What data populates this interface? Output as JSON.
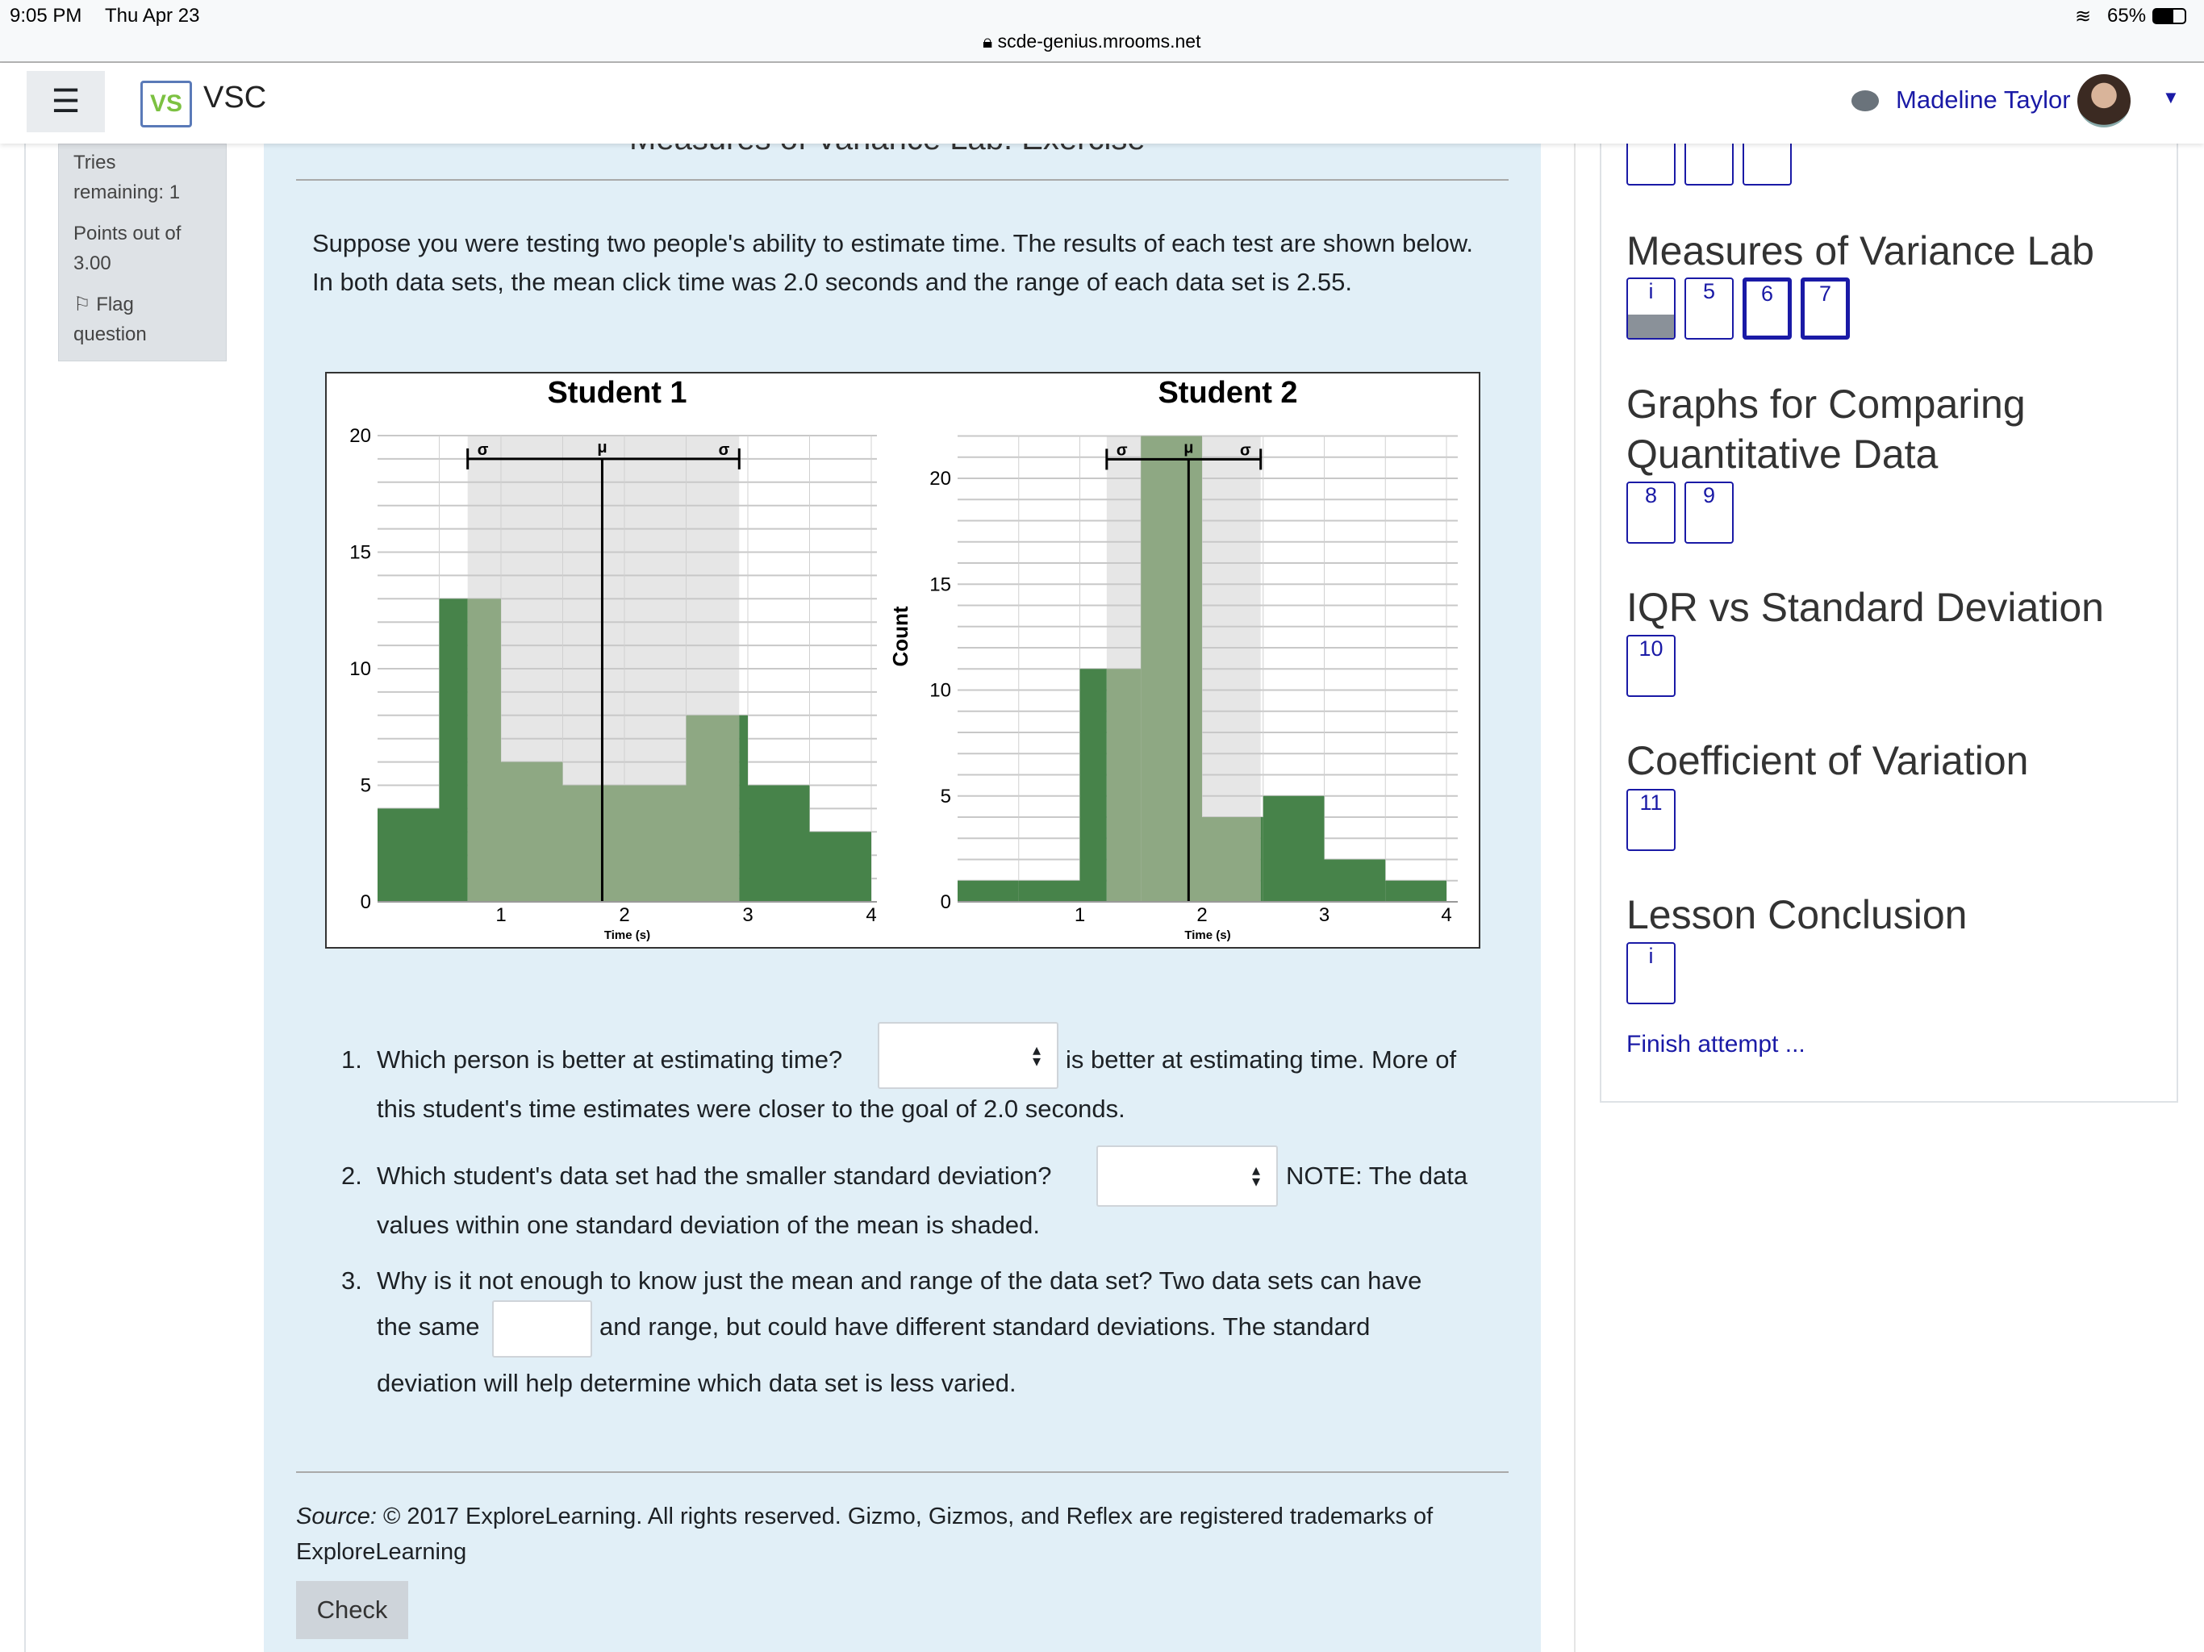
{
  "statusbar": {
    "time": "9:05 PM",
    "date": "Thu Apr 23",
    "url": "scde-genius.mrooms.net",
    "battery": "65%"
  },
  "header": {
    "site": "VSC",
    "user": "Madeline Taylor",
    "icons": [
      "menu-icon",
      "logo",
      "chat-icon",
      "avatar",
      "caret-down-icon"
    ]
  },
  "info": {
    "tries": "Tries remaining: 1",
    "points": "Points out of 3.00",
    "flag": "Flag question"
  },
  "main": {
    "title": "Measures of Variance Lab: Exercise",
    "intro": "Suppose you were testing two people's ability to estimate time. The results of each test are shown below. In both data sets, the mean click time was 2.0 seconds and the range of each data set is 2.55.",
    "q1_num": "1.",
    "q1_a": "Which person is better at estimating time?",
    "q1_b": "is better at estimating time. More of",
    "q1_c": "this student's time estimates were closer to the goal of 2.0 seconds.",
    "q2_num": "2.",
    "q2_a": "Which student's data set had the smaller standard deviation?",
    "q2_b": "NOTE: The data",
    "q2_c": "values within one standard deviation of the mean is shaded.",
    "q3_num": "3.",
    "q3_a": "Why is it not enough to know just the mean and range of the data set? Two data sets can have",
    "q3_b": "the same",
    "q3_c": "and range, but could have different standard deviations. The standard",
    "q3_d": "deviation will help determine which data set is less varied.",
    "select1": "",
    "select2": "",
    "input3": "",
    "source_label": "Source:",
    "source": " © 2017 ExploreLearning.  All rights reserved.  Gizmo, Gizmos, and Reflex are registered trademarks of",
    "source2": "ExploreLearning",
    "check": "Check"
  },
  "nav": {
    "sections": [
      {
        "title": "Measures of Variance Lab",
        "items": [
          "i",
          "5",
          "6",
          "7"
        ]
      },
      {
        "title": "Graphs for Comparing",
        "title2": "Quantitative Data",
        "items": [
          "8",
          "9"
        ]
      },
      {
        "title": "IQR vs Standard Deviation",
        "items": [
          "10"
        ]
      },
      {
        "title": "Coefficient of Variation",
        "items": [
          "11"
        ]
      },
      {
        "title": "Lesson Conclusion",
        "items": [
          "i"
        ]
      }
    ],
    "finish": "Finish attempt ..."
  },
  "chart_data": [
    {
      "type": "bar",
      "title": "Student 1",
      "xlabel": "Time (s)",
      "ylabel": "",
      "bin_edges": [
        0,
        0.5,
        1,
        1.5,
        2,
        2.5,
        3,
        3.5,
        4
      ],
      "values": [
        4,
        13,
        6,
        5,
        5,
        8,
        5,
        3
      ],
      "mean": 1.82,
      "sigma_range": [
        0.73,
        2.93
      ],
      "xticks": [
        "1",
        "2",
        "3",
        "4"
      ],
      "yticks": [
        "0",
        "5",
        "10",
        "15",
        "20"
      ],
      "ylim": [
        0,
        20
      ],
      "xlim": [
        0,
        4
      ],
      "grid": true,
      "colors": {
        "bar": "#47834a",
        "bar_in_sigma": "#8ea883",
        "sigma_shade": "#e6e6e6"
      },
      "markers": {
        "sigma": "σ",
        "mu": "μ"
      }
    },
    {
      "type": "bar",
      "title": "Student 2",
      "xlabel": "Time (s)",
      "ylabel": "Count",
      "bin_edges": [
        0,
        0.5,
        1,
        1.5,
        2,
        2.5,
        3,
        3.5,
        4
      ],
      "values": [
        1,
        1,
        11,
        22,
        4,
        5,
        2,
        1
      ],
      "mean": 1.89,
      "sigma_range": [
        1.22,
        2.48
      ],
      "xticks": [
        "1",
        "2",
        "3",
        "4"
      ],
      "yticks": [
        "0",
        "5",
        "10",
        "15",
        "20"
      ],
      "ylim": [
        0,
        22
      ],
      "xlim": [
        0,
        4
      ],
      "grid": true,
      "colors": {
        "bar": "#47834a",
        "bar_in_sigma": "#8ea883",
        "sigma_shade": "#e6e6e6"
      },
      "markers": {
        "sigma": "σ",
        "mu": "μ"
      }
    }
  ]
}
